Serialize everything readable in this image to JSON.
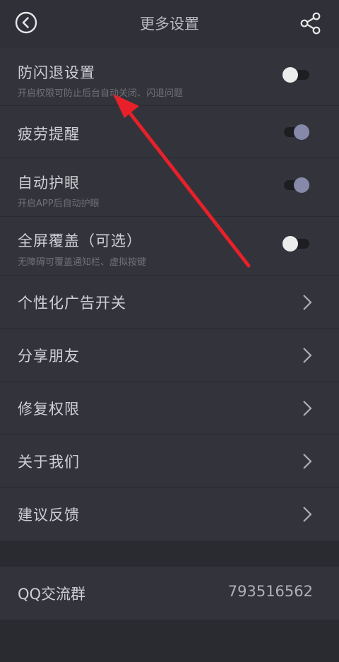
{
  "header": {
    "title": "更多设置",
    "back_icon": "back-circle-icon",
    "share_icon": "share-icon"
  },
  "toggles": [
    {
      "title": "防闪退设置",
      "subtitle": "开启权限可防止后台自动关闭、闪退问题",
      "state": "off"
    },
    {
      "title": "疲劳提醒",
      "subtitle": "",
      "state": "on"
    },
    {
      "title": "自动护眼",
      "subtitle": "开启APP后自动护眼",
      "state": "on"
    },
    {
      "title": "全屏覆盖（可选）",
      "subtitle": "无障碍可覆盖通知栏、虚拟按键",
      "state": "off"
    }
  ],
  "nav_items": [
    {
      "label": "个性化广告开关"
    },
    {
      "label": "分享朋友"
    },
    {
      "label": "修复权限"
    },
    {
      "label": "关于我们"
    },
    {
      "label": "建议反馈"
    }
  ],
  "qq_group": {
    "label": "QQ交流群",
    "value": "793516562"
  },
  "colors": {
    "background": "#2a2b31",
    "row_background": "#33343b",
    "toggle_on": "#8689a9",
    "toggle_off": "#ececec",
    "annotation_arrow": "#e8202a"
  }
}
